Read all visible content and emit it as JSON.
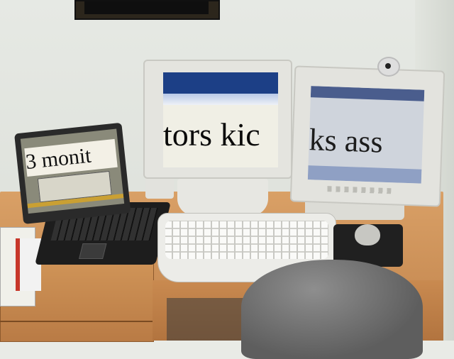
{
  "laptop_screen_text": "3 monit",
  "center_monitor_text": "tors kic",
  "right_monitor_text": "ks ass"
}
